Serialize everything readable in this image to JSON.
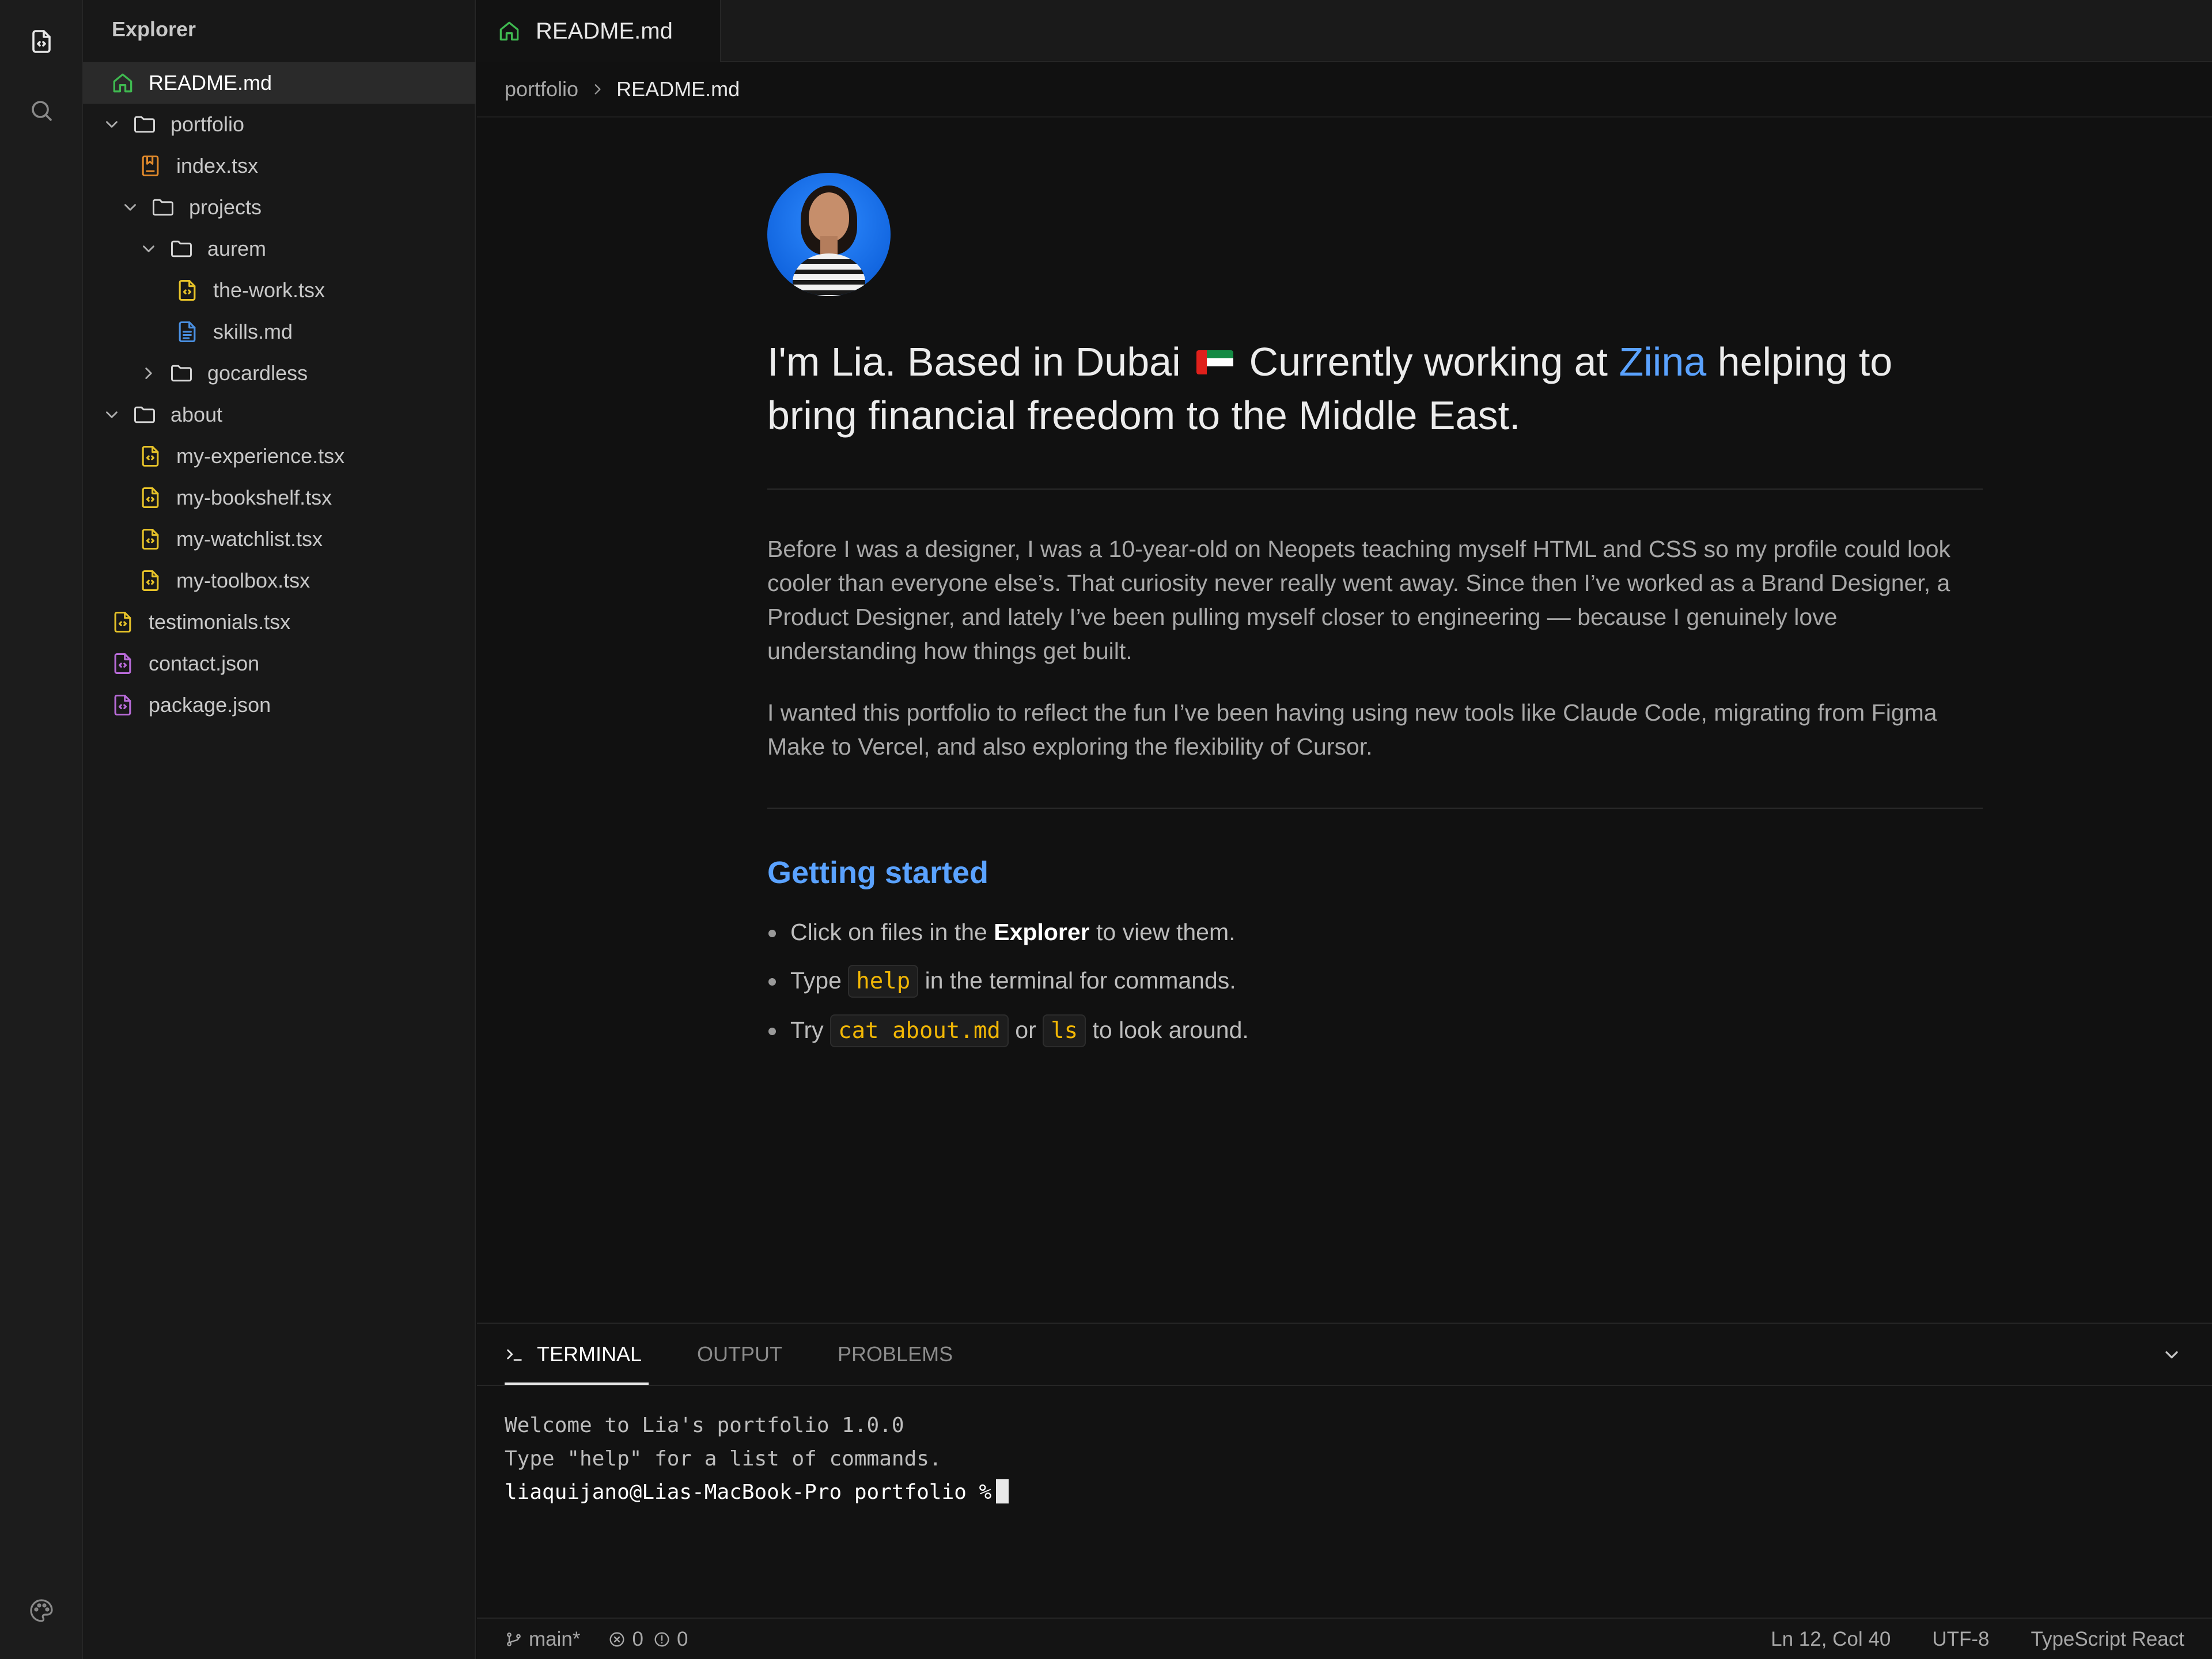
{
  "colors": {
    "accent_blue": "#5aa2ff",
    "inline_code": "#f2b705",
    "tsx_icon": "#e6c229",
    "md_icon": "#4a90e2",
    "json_icon": "#b86bd8",
    "home_icon": "#3fb950",
    "index_icon": "#e0892b",
    "background": "#111111"
  },
  "activity_bar": {
    "items": [
      {
        "name": "explorer",
        "icon": "file-code-icon"
      },
      {
        "name": "search",
        "icon": "search-icon"
      },
      {
        "name": "theme",
        "icon": "palette-icon"
      }
    ]
  },
  "sidebar": {
    "title": "Explorer",
    "tree": [
      {
        "label": "README.md",
        "icon": "home-icon",
        "chevron": "none",
        "active": true
      },
      {
        "label": "portfolio",
        "icon": "folder-icon",
        "chevron": "down"
      },
      {
        "label": "index.tsx",
        "icon": "bookmark-file-icon",
        "chevron": "none"
      },
      {
        "label": "projects",
        "icon": "folder-icon",
        "chevron": "down"
      },
      {
        "label": "aurem",
        "icon": "folder-icon",
        "chevron": "down"
      },
      {
        "label": "the-work.tsx",
        "icon": "tsx-file-icon",
        "chevron": "none"
      },
      {
        "label": "skills.md",
        "icon": "md-file-icon",
        "chevron": "none"
      },
      {
        "label": "gocardless",
        "icon": "folder-icon",
        "chevron": "right"
      },
      {
        "label": "about",
        "icon": "folder-icon",
        "chevron": "down"
      },
      {
        "label": "my-experience.tsx",
        "icon": "tsx-file-icon",
        "chevron": "none"
      },
      {
        "label": "my-bookshelf.tsx",
        "icon": "tsx-file-icon",
        "chevron": "none"
      },
      {
        "label": "my-watchlist.tsx",
        "icon": "tsx-file-icon",
        "chevron": "none"
      },
      {
        "label": "my-toolbox.tsx",
        "icon": "tsx-file-icon",
        "chevron": "none"
      },
      {
        "label": "testimonials.tsx",
        "icon": "tsx-file-icon",
        "chevron": "none"
      },
      {
        "label": "contact.json",
        "icon": "json-file-icon",
        "chevron": "none"
      },
      {
        "label": "package.json",
        "icon": "json-file-icon",
        "chevron": "none"
      }
    ]
  },
  "tabs": [
    {
      "label": "README.md",
      "icon": "home-icon"
    }
  ],
  "breadcrumb": {
    "items": [
      "portfolio",
      "README.md"
    ]
  },
  "readme": {
    "avatar_alt": "profile-photo",
    "headline": {
      "part1": "I'm Lia. Based in Dubai",
      "part2": "Currently working at",
      "link": "Ziina",
      "part3": "helping to bring financial freedom to the Middle East."
    },
    "paragraphs": [
      "Before I was a designer, I was a 10-year-old on Neopets teaching myself HTML and CSS so my profile could look cooler than everyone else’s. That curiosity never really went away. Since then I’ve worked as a Brand Designer, a Product Designer, and lately I’ve been pulling myself closer to engineering — because I genuinely love understanding how things get built.",
      "I wanted this portfolio to reflect the fun I’ve been having using new tools like Claude Code, migrating from Figma Make to Vercel, and also exploring the flexibility of Cursor."
    ],
    "getting_started": {
      "heading": "Getting started",
      "bullet1": {
        "pre": "Click on files in the",
        "bold": "Explorer",
        "post": "to view them."
      },
      "bullet2": {
        "pre": "Type",
        "code": "help",
        "post": "in the terminal for commands."
      },
      "bullet3": {
        "pre": "Try",
        "code1": "cat about.md",
        "mid": "or",
        "code2": "ls",
        "post": "to look around."
      }
    }
  },
  "panel": {
    "tabs": [
      "TERMINAL",
      "OUTPUT",
      "PROBLEMS"
    ],
    "active_tab": "TERMINAL",
    "terminal_lines": [
      "Welcome to Lia's portfolio 1.0.0",
      "Type \"help\" for a list of commands."
    ],
    "prompt": "liaquijano@Lias-MacBook-Pro portfolio %"
  },
  "status_bar": {
    "branch": "main*",
    "errors": "0",
    "warnings": "0",
    "cursor_position": "Ln 12, Col 40",
    "encoding": "UTF-8",
    "language": "TypeScript React"
  }
}
